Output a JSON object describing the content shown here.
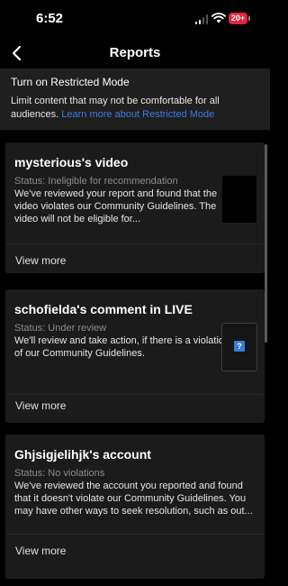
{
  "status_bar": {
    "time": "6:52",
    "battery": "20+"
  },
  "nav": {
    "title": "Reports"
  },
  "banner": {
    "title": "Turn on Restricted Mode",
    "text": "Limit content that may not be comfortable for all audiences.",
    "link": "Learn more about Restricted Mode"
  },
  "reports": [
    {
      "title": "mysterious's video",
      "status": "Status: Ineligible for recommendation",
      "body": "We've reviewed your report and found that the video violates our Community Guidelines. The video will not be eligible for...",
      "view_more": "View more"
    },
    {
      "title": "schofielda's comment in LIVE",
      "status": "Status: Under review",
      "body": "We'll review and take action, if there is a violation of our Community Guidelines.",
      "view_more": "View more"
    },
    {
      "title": "Ghjsigjelihjk's account",
      "status": "Status: No violations",
      "body": "We've reviewed the account you reported and found that it doesn't violate our Community Guidelines. You may have other ways to seek resolution, such as out...",
      "view_more": "View more"
    }
  ],
  "colors": {
    "link": "#3d7be0",
    "battery": "#e5243b",
    "card": "#1b1b1b",
    "banner": "#1f1f1f"
  }
}
